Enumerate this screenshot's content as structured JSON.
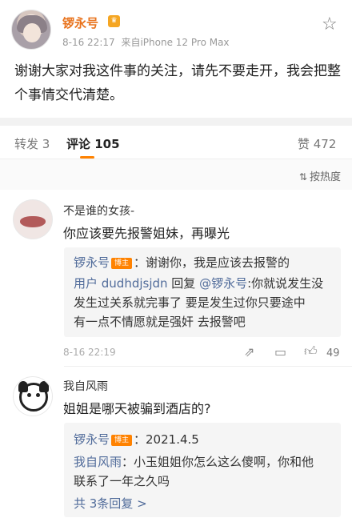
{
  "post": {
    "author": "锣永号",
    "time": "8-16 22:17",
    "source": "来自iPhone 12 Pro Max",
    "body": "谢谢大家对我这件事的关注，请先不要走开，我会把整个事情交代清楚。"
  },
  "tabs": {
    "repost": "转发 3",
    "comments": "评论 105",
    "likes": "赞 472"
  },
  "sort": {
    "label": "按热度",
    "icon": "⇅"
  },
  "comments": [
    {
      "user": "不是谁的女孩-",
      "text": "你应该要先报警姐妹，再曝光",
      "replies": {
        "r1_user": "锣永号",
        "r1_badge": "博主",
        "r1_text": "：谢谢你，我是应该去报警的",
        "r2_user": "用户 dudhdjsjdn",
        "r2_mid": " 回复 ",
        "r2_target": "@锣永号",
        "r2_text": ":你就说发生没",
        "r2_line2": "发生过关系就完事了 要是发生过你只要途中",
        "r2_line3": "有一点不情愿就是强奸 去报警吧"
      },
      "time": "8-16 22:19",
      "likes": "49"
    },
    {
      "user": "我自风雨",
      "text": "姐姐是哪天被骗到酒店的?",
      "replies": {
        "r1_user": "锣永号",
        "r1_badge": "博主",
        "r1_text": "：2021.4.5",
        "r2_user": "我自风雨",
        "r2_text": "：小玉姐姐你怎么这么傻啊，你和他",
        "r2_line2": "联系了一年之久吗",
        "more": "共 3条回复 >"
      }
    }
  ]
}
